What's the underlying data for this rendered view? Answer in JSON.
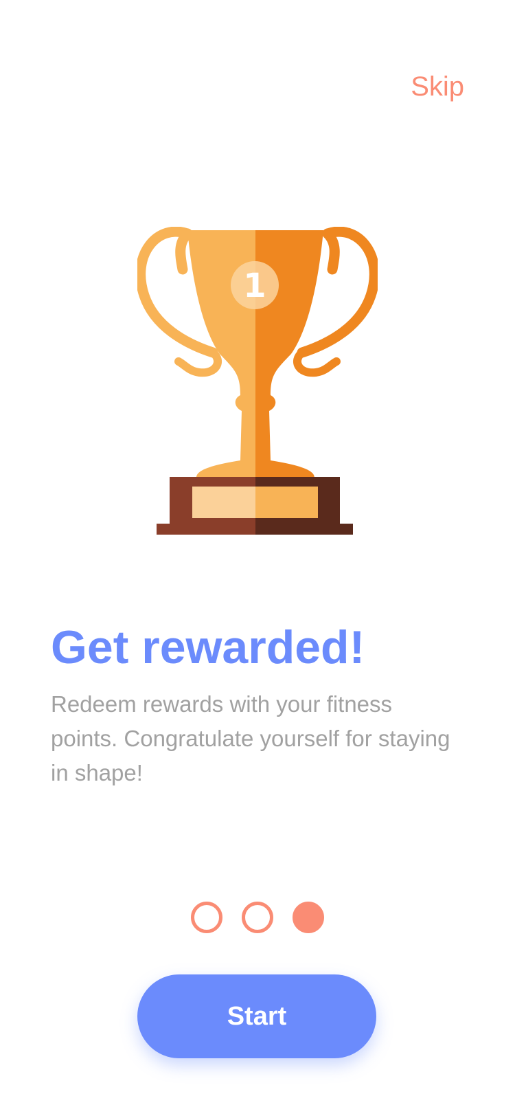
{
  "header": {
    "skip_label": "Skip"
  },
  "illustration": {
    "icon": "trophy-icon",
    "badge_number": "1"
  },
  "content": {
    "title": "Get rewarded!",
    "description": "Redeem rewards with your fitness points. Congratulate yourself for staying in shape!"
  },
  "pagination": {
    "total_pages": 3,
    "current_page": 3
  },
  "actions": {
    "start_label": "Start"
  },
  "colors": {
    "accent_blue": "#6b8bfc",
    "accent_coral": "#fa8c74",
    "trophy_light": "#f8b356",
    "trophy_dark": "#ef8720",
    "base_light": "#8a3e2a",
    "base_dark": "#5a2a1c"
  }
}
